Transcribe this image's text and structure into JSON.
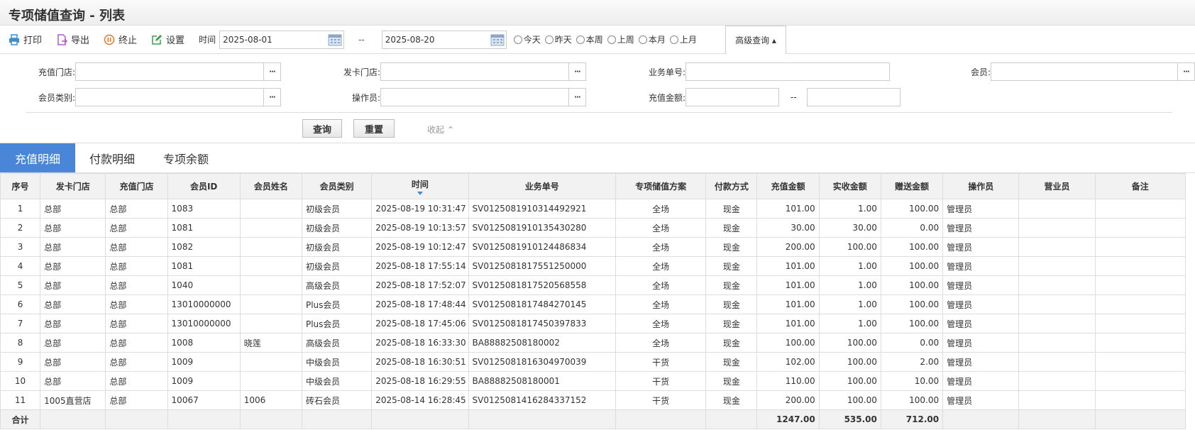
{
  "page_title": "专项储值查询 - 列表",
  "toolbar": {
    "print": "打印",
    "export": "导出",
    "stop": "终止",
    "settings": "设置",
    "time_label": "时间",
    "date_from": "2025-08-01",
    "date_sep": "--",
    "date_to": "2025-08-20",
    "radios": [
      "今天",
      "昨天",
      "本周",
      "上周",
      "本月",
      "上月"
    ],
    "advanced": "高级查询 ▴"
  },
  "search": {
    "recharge_store": "充值门店:",
    "card_store": "发卡门店:",
    "doc_no": "业务单号:",
    "member": "会员:",
    "member_type": "会员类别:",
    "operator": "操作员:",
    "amount": "充值金额:",
    "amount_sep": "--",
    "query_btn": "查询",
    "reset_btn": "重置",
    "collapse": "收起 ⌃"
  },
  "tabs": [
    "充值明细",
    "付款明细",
    "专项余额"
  ],
  "table": {
    "headers": [
      "序号",
      "发卡门店",
      "充值门店",
      "会员ID",
      "会员姓名",
      "会员类别",
      "时间",
      "业务单号",
      "专项储值方案",
      "付款方式",
      "充值金额",
      "实收金额",
      "赠送金额",
      "操作员",
      "营业员",
      "备注"
    ],
    "rows": [
      [
        "1",
        "总部",
        "总部",
        "1083",
        "",
        "初级会员",
        "2025-08-19 10:31:47",
        "SV0125081910314492921",
        "全场",
        "现金",
        "101.00",
        "1.00",
        "100.00",
        "管理员",
        "",
        ""
      ],
      [
        "2",
        "总部",
        "总部",
        "1081",
        "",
        "初级会员",
        "2025-08-19 10:13:57",
        "SV0125081910135430280",
        "全场",
        "现金",
        "30.00",
        "30.00",
        "0.00",
        "管理员",
        "",
        ""
      ],
      [
        "3",
        "总部",
        "总部",
        "1082",
        "",
        "初级会员",
        "2025-08-19 10:12:47",
        "SV0125081910124486834",
        "全场",
        "现金",
        "200.00",
        "100.00",
        "100.00",
        "管理员",
        "",
        ""
      ],
      [
        "4",
        "总部",
        "总部",
        "1081",
        "",
        "初级会员",
        "2025-08-18 17:55:14",
        "SV0125081817551250000",
        "全场",
        "现金",
        "101.00",
        "1.00",
        "100.00",
        "管理员",
        "",
        ""
      ],
      [
        "5",
        "总部",
        "总部",
        "1040",
        "",
        "高级会员",
        "2025-08-18 17:52:07",
        "SV0125081817520568558",
        "全场",
        "现金",
        "101.00",
        "1.00",
        "100.00",
        "管理员",
        "",
        ""
      ],
      [
        "6",
        "总部",
        "总部",
        "13010000000",
        "",
        "Plus会员",
        "2025-08-18 17:48:44",
        "SV0125081817484270145",
        "全场",
        "现金",
        "101.00",
        "1.00",
        "100.00",
        "管理员",
        "",
        ""
      ],
      [
        "7",
        "总部",
        "总部",
        "13010000000",
        "",
        "Plus会员",
        "2025-08-18 17:45:06",
        "SV0125081817450397833",
        "全场",
        "现金",
        "101.00",
        "1.00",
        "100.00",
        "管理员",
        "",
        ""
      ],
      [
        "8",
        "总部",
        "总部",
        "1008",
        "晓莲",
        "高级会员",
        "2025-08-18 16:33:30",
        "BA88882508180002",
        "全场",
        "现金",
        "100.00",
        "100.00",
        "0.00",
        "管理员",
        "",
        ""
      ],
      [
        "9",
        "总部",
        "总部",
        "1009",
        "",
        "中级会员",
        "2025-08-18 16:30:51",
        "SV0125081816304970039",
        "干货",
        "现金",
        "102.00",
        "100.00",
        "2.00",
        "管理员",
        "",
        ""
      ],
      [
        "10",
        "总部",
        "总部",
        "1009",
        "",
        "中级会员",
        "2025-08-18 16:29:55",
        "BA88882508180001",
        "干货",
        "现金",
        "110.00",
        "100.00",
        "10.00",
        "管理员",
        "",
        ""
      ],
      [
        "11",
        "1005直营店",
        "总部",
        "10067",
        "1006",
        "砖石会员",
        "2025-08-14 16:28:45",
        "SV0125081416284337152",
        "干货",
        "现金",
        "200.00",
        "100.00",
        "100.00",
        "管理员",
        "",
        ""
      ]
    ],
    "footer": {
      "label": "合计",
      "recharge_total": "1247.00",
      "received_total": "535.00",
      "bonus_total": "712.00"
    }
  },
  "colors": {
    "accent": "#4a86d8"
  }
}
